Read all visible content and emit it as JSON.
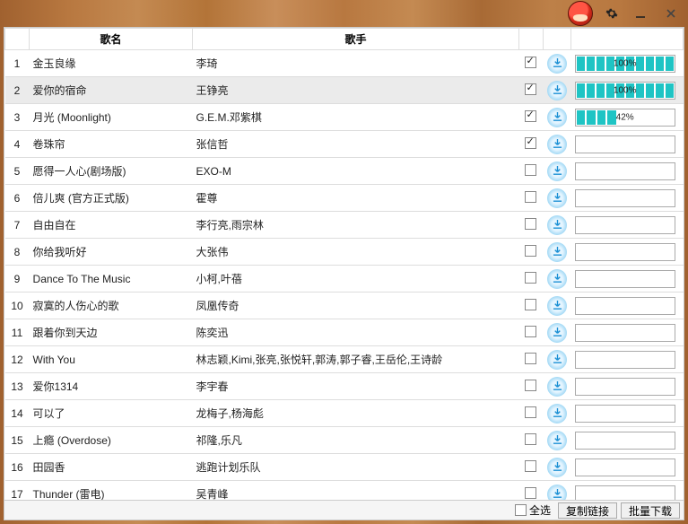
{
  "headers": {
    "song": "歌名",
    "artist": "歌手"
  },
  "rows": [
    {
      "n": 1,
      "song": "金玉良缘",
      "artist": "李琦",
      "checked": true,
      "progress": 100,
      "label": "100%"
    },
    {
      "n": 2,
      "song": "爱你的宿命",
      "artist": "王铮亮",
      "checked": true,
      "progress": 100,
      "label": "100%",
      "selected": true
    },
    {
      "n": 3,
      "song": "月光 (Moonlight)",
      "artist": "G.E.M.邓紫棋",
      "checked": true,
      "progress": 42,
      "label": "42%"
    },
    {
      "n": 4,
      "song": "卷珠帘",
      "artist": "张信哲",
      "checked": true,
      "progress": 0
    },
    {
      "n": 5,
      "song": "愿得一人心(剧场版)",
      "artist": "EXO-M",
      "checked": false,
      "progress": 0
    },
    {
      "n": 6,
      "song": "倍儿爽 (官方正式版)",
      "artist": "霍尊",
      "checked": false,
      "progress": 0
    },
    {
      "n": 7,
      "song": "自由自在",
      "artist": "李行亮,雨宗林",
      "checked": false,
      "progress": 0
    },
    {
      "n": 8,
      "song": "你给我听好",
      "artist": "大张伟",
      "checked": false,
      "progress": 0
    },
    {
      "n": 9,
      "song": "Dance To The Music",
      "artist": "小柯,叶蓓",
      "checked": false,
      "progress": 0
    },
    {
      "n": 10,
      "song": "寂寞的人伤心的歌",
      "artist": "凤凰传奇",
      "checked": false,
      "progress": 0
    },
    {
      "n": 11,
      "song": "跟着你到天边",
      "artist": "陈奕迅",
      "checked": false,
      "progress": 0
    },
    {
      "n": 12,
      "song": "With You",
      "artist": "林志颖,Kimi,张亮,张悦轩,郭涛,郭子睿,王岳伦,王诗龄",
      "checked": false,
      "progress": 0
    },
    {
      "n": 13,
      "song": "爱你1314",
      "artist": "李宇春",
      "checked": false,
      "progress": 0
    },
    {
      "n": 14,
      "song": "可以了",
      "artist": "龙梅子,杨海彪",
      "checked": false,
      "progress": 0
    },
    {
      "n": 15,
      "song": "上瘾 (Overdose)",
      "artist": "祁隆,乐凡",
      "checked": false,
      "progress": 0
    },
    {
      "n": 16,
      "song": "田园香",
      "artist": "逃跑计划乐队",
      "checked": false,
      "progress": 0
    },
    {
      "n": 17,
      "song": "Thunder (雷电)",
      "artist": "吴青峰",
      "checked": false,
      "progress": 0
    }
  ],
  "footer": {
    "select_all": "全选",
    "copy_link": "复制链接",
    "batch_download": "批量下载"
  }
}
